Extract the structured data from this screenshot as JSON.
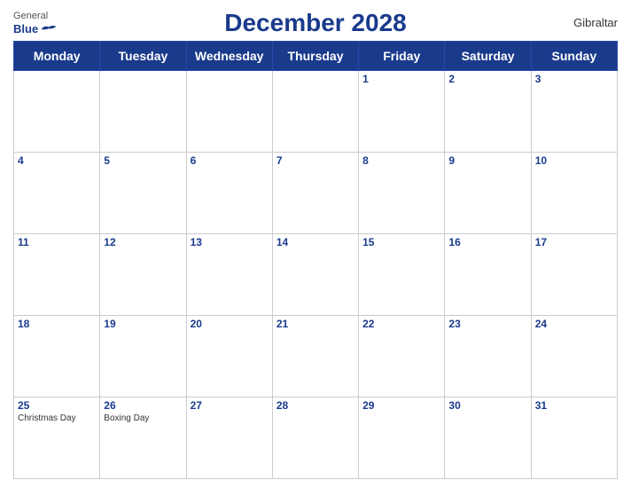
{
  "header": {
    "logo_general": "General",
    "logo_blue": "Blue",
    "title": "December 2028",
    "country": "Gibraltar"
  },
  "days_of_week": [
    "Monday",
    "Tuesday",
    "Wednesday",
    "Thursday",
    "Friday",
    "Saturday",
    "Sunday"
  ],
  "weeks": [
    [
      {
        "number": "",
        "holiday": ""
      },
      {
        "number": "",
        "holiday": ""
      },
      {
        "number": "",
        "holiday": ""
      },
      {
        "number": "",
        "holiday": ""
      },
      {
        "number": "1",
        "holiday": ""
      },
      {
        "number": "2",
        "holiday": ""
      },
      {
        "number": "3",
        "holiday": ""
      }
    ],
    [
      {
        "number": "4",
        "holiday": ""
      },
      {
        "number": "5",
        "holiday": ""
      },
      {
        "number": "6",
        "holiday": ""
      },
      {
        "number": "7",
        "holiday": ""
      },
      {
        "number": "8",
        "holiday": ""
      },
      {
        "number": "9",
        "holiday": ""
      },
      {
        "number": "10",
        "holiday": ""
      }
    ],
    [
      {
        "number": "11",
        "holiday": ""
      },
      {
        "number": "12",
        "holiday": ""
      },
      {
        "number": "13",
        "holiday": ""
      },
      {
        "number": "14",
        "holiday": ""
      },
      {
        "number": "15",
        "holiday": ""
      },
      {
        "number": "16",
        "holiday": ""
      },
      {
        "number": "17",
        "holiday": ""
      }
    ],
    [
      {
        "number": "18",
        "holiday": ""
      },
      {
        "number": "19",
        "holiday": ""
      },
      {
        "number": "20",
        "holiday": ""
      },
      {
        "number": "21",
        "holiday": ""
      },
      {
        "number": "22",
        "holiday": ""
      },
      {
        "number": "23",
        "holiday": ""
      },
      {
        "number": "24",
        "holiday": ""
      }
    ],
    [
      {
        "number": "25",
        "holiday": "Christmas Day"
      },
      {
        "number": "26",
        "holiday": "Boxing Day"
      },
      {
        "number": "27",
        "holiday": ""
      },
      {
        "number": "28",
        "holiday": ""
      },
      {
        "number": "29",
        "holiday": ""
      },
      {
        "number": "30",
        "holiday": ""
      },
      {
        "number": "31",
        "holiday": ""
      }
    ]
  ]
}
